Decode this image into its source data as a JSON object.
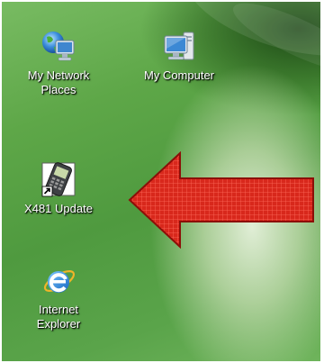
{
  "desktop": {
    "icons": [
      {
        "label_line1": "My Network",
        "label_line2": "Places",
        "icon": "network-places-icon"
      },
      {
        "label_line1": "My Computer",
        "label_line2": "",
        "icon": "my-computer-icon"
      },
      {
        "label_line1": "X481 Update",
        "label_line2": "",
        "icon": "phone-shortcut-icon"
      },
      {
        "label_line1": "Internet",
        "label_line2": "Explorer",
        "icon": "internet-explorer-icon"
      }
    ]
  },
  "annotation": {
    "icon": "red-arrow-icon",
    "color": "#d8281c",
    "direction": "left"
  },
  "colors": {
    "desktop_green": "#5ea748",
    "label_text": "#ffffff"
  }
}
